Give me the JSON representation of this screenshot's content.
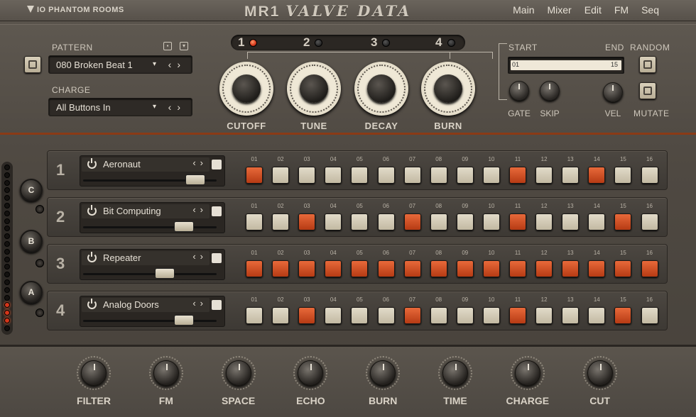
{
  "header": {
    "brand": "IO PHANTOM ROOMS",
    "product_main": "MR1",
    "product_sub": "VALVE DATA",
    "nav": [
      "Main",
      "Mixer",
      "Edit",
      "FM",
      "Seq"
    ]
  },
  "pattern": {
    "label": "PATTERN",
    "value": "080 Broken Beat 1"
  },
  "charge": {
    "label": "CHARGE",
    "value": "All Buttons In"
  },
  "mod_selector": {
    "items": [
      "1",
      "2",
      "3",
      "4"
    ],
    "active": "1"
  },
  "big_knobs": [
    "CUTOFF",
    "TUNE",
    "DECAY",
    "BURN"
  ],
  "sequence": {
    "start_label": "START",
    "end_label": "END",
    "start_value": "01",
    "end_value": "15",
    "random_label": "RANDOM",
    "mutate_label": "MUTATE",
    "gate_label": "GATE",
    "skip_label": "SKIP",
    "vel_label": "VEL"
  },
  "side_buttons": [
    "C",
    "B",
    "A"
  ],
  "step_numbers": [
    "01",
    "02",
    "03",
    "04",
    "05",
    "06",
    "07",
    "08",
    "09",
    "10",
    "11",
    "12",
    "13",
    "14",
    "15",
    "16"
  ],
  "tracks": [
    {
      "number": "1",
      "name": "Aeronaut",
      "slider": 0.9,
      "steps": [
        1,
        0,
        0,
        0,
        0,
        0,
        0,
        0,
        0,
        0,
        1,
        0,
        0,
        1,
        0,
        0
      ]
    },
    {
      "number": "2",
      "name": "Bit Computing",
      "slider": 0.8,
      "steps": [
        0,
        0,
        1,
        0,
        0,
        0,
        1,
        0,
        0,
        0,
        1,
        0,
        0,
        0,
        1,
        0
      ]
    },
    {
      "number": "3",
      "name": "Repeater",
      "slider": 0.63,
      "steps": [
        1,
        1,
        1,
        1,
        1,
        1,
        1,
        1,
        1,
        1,
        1,
        1,
        1,
        1,
        1,
        1
      ]
    },
    {
      "number": "4",
      "name": "Analog Doors",
      "slider": 0.8,
      "steps": [
        0,
        0,
        1,
        0,
        0,
        0,
        1,
        0,
        0,
        0,
        1,
        0,
        0,
        0,
        1,
        0
      ]
    }
  ],
  "bottom_knobs": [
    "FILTER",
    "FM",
    "SPACE",
    "ECHO",
    "BURN",
    "TIME",
    "CHARGE",
    "CUT"
  ]
}
